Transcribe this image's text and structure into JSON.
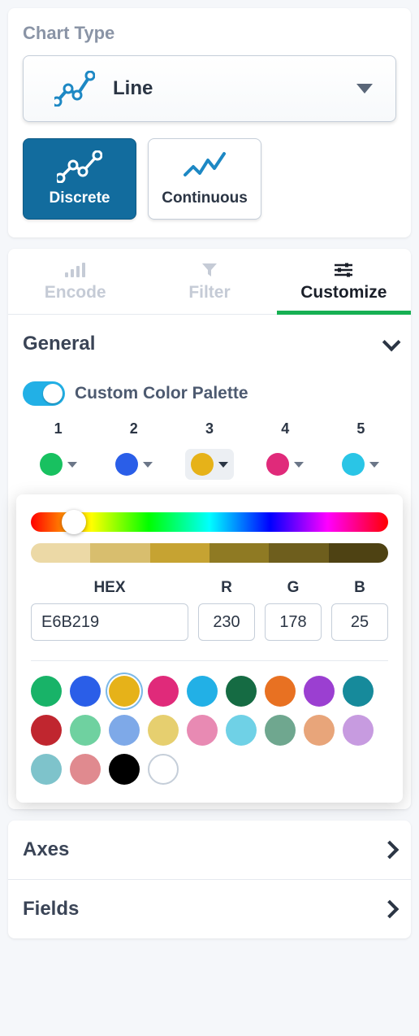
{
  "chartType": {
    "title": "Chart Type",
    "selected": "Line",
    "modes": [
      {
        "label": "Discrete",
        "active": true
      },
      {
        "label": "Continuous",
        "active": false
      }
    ]
  },
  "tabs": [
    {
      "label": "Encode",
      "active": false
    },
    {
      "label": "Filter",
      "active": false
    },
    {
      "label": "Customize",
      "active": true
    }
  ],
  "general": {
    "label": "General",
    "expanded": true,
    "customPalette": {
      "label": "Custom Color Palette",
      "enabled": true
    },
    "swatches": [
      {
        "n": "1",
        "color": "#18c160"
      },
      {
        "n": "2",
        "color": "#2a5ee8"
      },
      {
        "n": "3",
        "color": "#e6b219",
        "selected": true
      },
      {
        "n": "4",
        "color": "#e02a7a"
      },
      {
        "n": "5",
        "color": "#2ac5e6"
      }
    ],
    "picker": {
      "hexLabel": "HEX",
      "hex": "E6B219",
      "rLabel": "R",
      "r": "230",
      "gLabel": "G",
      "g": "178",
      "bLabel": "B",
      "b": "25",
      "shades": [
        "#ecd9a6",
        "#d8be6e",
        "#c6a332",
        "#8f7a23",
        "#6e5e1d",
        "#4e4213"
      ],
      "presets": [
        "#18b368",
        "#2a5ee8",
        "#e6b219",
        "#e02a7a",
        "#22b0e6",
        "#156b43",
        "#e87122",
        "#9b3fd1",
        "#168a9b",
        "#c0262f",
        "#6fd1a0",
        "#7ea9e8",
        "#e6cf6f",
        "#e88ab3",
        "#6fd1e6",
        "#6fa78f",
        "#e8a57a",
        "#c79be0",
        "#7ec3cb",
        "#e08a8f",
        "#000000"
      ],
      "selectedPresetIndex": 2
    }
  },
  "axes": {
    "label": "Axes"
  },
  "fields": {
    "label": "Fields"
  }
}
